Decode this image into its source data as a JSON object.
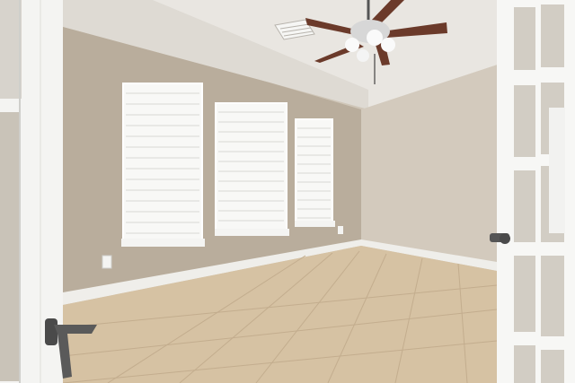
{
  "scene": {
    "subject": "",
    "colors": {
      "wall_left": "#b9ad9c",
      "wall_back": "#c8bdae",
      "wall_right": "#d3cabd",
      "ceiling": "#e9e6e1",
      "floor": "#d6c2a3",
      "baseboard": "#efeeea",
      "blinds": "#f3f3f1",
      "door_frame": "#f4f4f2",
      "fan_blade": "#6b3a2a"
    },
    "elements": {
      "windows_count": 3,
      "door_panes": "french-door",
      "ceiling_fan": "ceiling-fan-with-light",
      "air_vent": "ceiling-vent",
      "outlet": "wall-outlet"
    }
  }
}
